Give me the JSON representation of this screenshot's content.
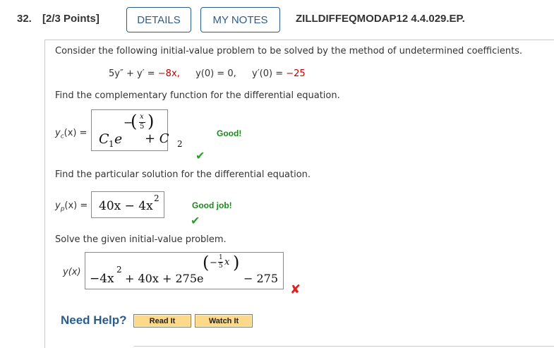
{
  "header": {
    "question_number": "32.",
    "points": "[2/3 Points]",
    "details_label": "DETAILS",
    "my_notes_label": "MY NOTES",
    "question_id": "ZILLDIFFEQMODAP12 4.4.029.EP."
  },
  "problem": {
    "intro": "Consider the following initial-value problem to be solved by the method of undetermined coefficients.",
    "equation_lhs": "5y″ + y′ = ",
    "equation_rhs1": "−8x,",
    "ic1_lhs": "y(0) = 0,",
    "ic2_lhs": "y′(0) = ",
    "ic2_val": "−25"
  },
  "part1": {
    "prompt": "Find the complementary function for the differential equation.",
    "label_y": "y",
    "label_sub": "c",
    "label_rest": "(x) =",
    "answer": {
      "c1": "C",
      "c1_sub": "1",
      "e": "e",
      "exp_minus": "−",
      "exp_num": "x",
      "exp_den": "5",
      "plus": "+ C",
      "c2_sub": "2"
    },
    "feedback": "Good!",
    "status": "correct"
  },
  "part2": {
    "prompt": "Find the particular solution for the differential equation.",
    "label_y": "y",
    "label_sub": "p",
    "label_rest": "(x) =",
    "answer": {
      "main": "40x − 4x",
      "sup": "2"
    },
    "feedback": "Good job!",
    "status": "correct"
  },
  "part3": {
    "prompt": "Solve the given initial-value problem.",
    "label": "y(x) =",
    "answer": {
      "lead": "−4x",
      "lead_sup": "2",
      "mid": "+ 40x + 275e",
      "exp_minus": "−",
      "exp_num": "1",
      "exp_den": "5",
      "exp_x": "x",
      "tail": "− 275"
    },
    "status": "incorrect"
  },
  "help": {
    "label": "Need Help?",
    "read_it": "Read It",
    "watch_it": "Watch It"
  },
  "colors": {
    "accent": "#2a5d8c",
    "correct": "#1a8a1a",
    "incorrect": "#dd2222",
    "highlight": "#c00000"
  }
}
